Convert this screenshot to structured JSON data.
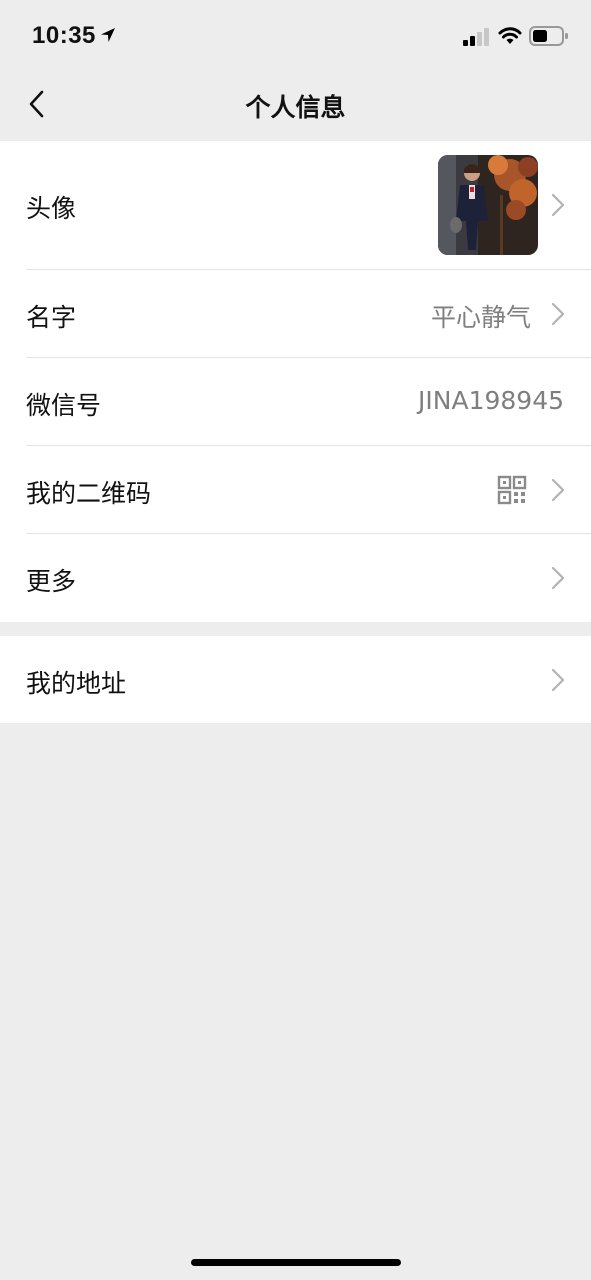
{
  "status_bar": {
    "time": "10:35",
    "icons": [
      "location-arrow-icon",
      "cellular-signal-icon",
      "wifi-icon",
      "battery-icon"
    ]
  },
  "nav": {
    "title": "个人信息",
    "back_icon": "chevron-left-icon"
  },
  "rows": [
    {
      "label": "头像",
      "value_type": "avatar-image",
      "chevron": true
    },
    {
      "label": "名字",
      "value": "平心静气",
      "chevron": true
    },
    {
      "label": "微信号",
      "value": "JINA198945",
      "chevron": false
    },
    {
      "label": "我的二维码",
      "value_icon": "qr-code-icon",
      "chevron": true
    },
    {
      "label": "更多",
      "chevron": true
    }
  ],
  "rows2": [
    {
      "label": "我的地址",
      "chevron": true
    }
  ],
  "colors": {
    "background": "#ededed",
    "card": "#ffffff",
    "label_text": "#111111",
    "value_text": "#7f7f7f",
    "chevron": "#b2b2b2",
    "divider": "#e3e3e3"
  }
}
